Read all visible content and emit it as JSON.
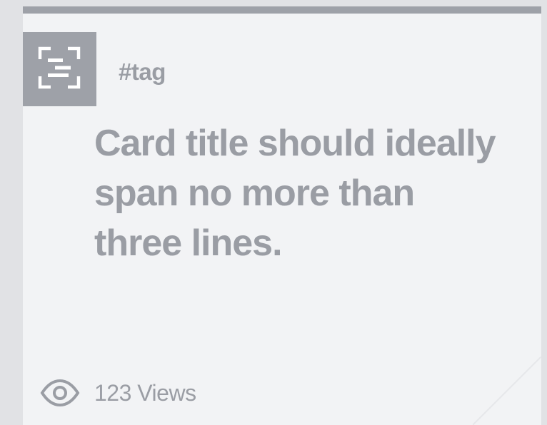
{
  "card": {
    "tag": "#tag",
    "title": "Card title should ideally span no more than three lines.",
    "views_label": "123 Views",
    "icons": {
      "thumbnail": "scan-image-icon",
      "views": "eye-icon"
    }
  },
  "colors": {
    "page_background": "#e1e2e5",
    "card_background": "#f2f3f5",
    "accent_bar": "#9ea1a8",
    "text": "#9a9da4"
  }
}
